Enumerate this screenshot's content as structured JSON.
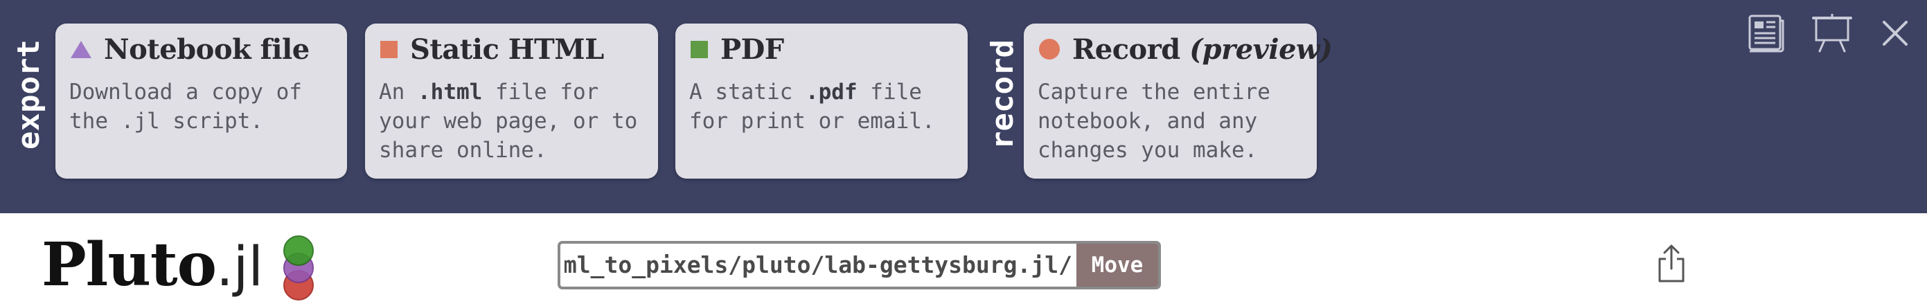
{
  "export_bar": {
    "export_label": "export",
    "record_label": "record",
    "cards": {
      "notebook": {
        "title": "Notebook file",
        "description": "Download a copy of\nthe .jl script.",
        "icon": "triangle-icon",
        "icon_color": "#9f79c7"
      },
      "html": {
        "title": "Static HTML",
        "description_parts": [
          "An ",
          ".html",
          " file for\nyour web page, or to\nshare online."
        ],
        "icon": "square-icon",
        "icon_color": "#e07a5f"
      },
      "pdf": {
        "title": "PDF",
        "description_parts": [
          "A static ",
          ".pdf",
          " file\nfor print or email."
        ],
        "icon": "square-icon",
        "icon_color": "#5f9b45"
      },
      "record": {
        "title": "Record",
        "title_suffix": "(preview)",
        "description": "Capture the entire\nnotebook, and any\nchanges you make.",
        "icon": "circle-icon",
        "icon_color": "#e07a5f"
      }
    },
    "controls": [
      "notebook-view-icon",
      "present-icon",
      "close-icon"
    ],
    "background": "#3d4263"
  },
  "header": {
    "logo_text": "Pluto",
    "logo_suffix": ".jl",
    "path_value": "/home/user/html_to_pixels/pluto/lab-gettysburg.jl",
    "move_label": "Move",
    "move_color": "#8a7474",
    "share_icon": "share-icon"
  }
}
